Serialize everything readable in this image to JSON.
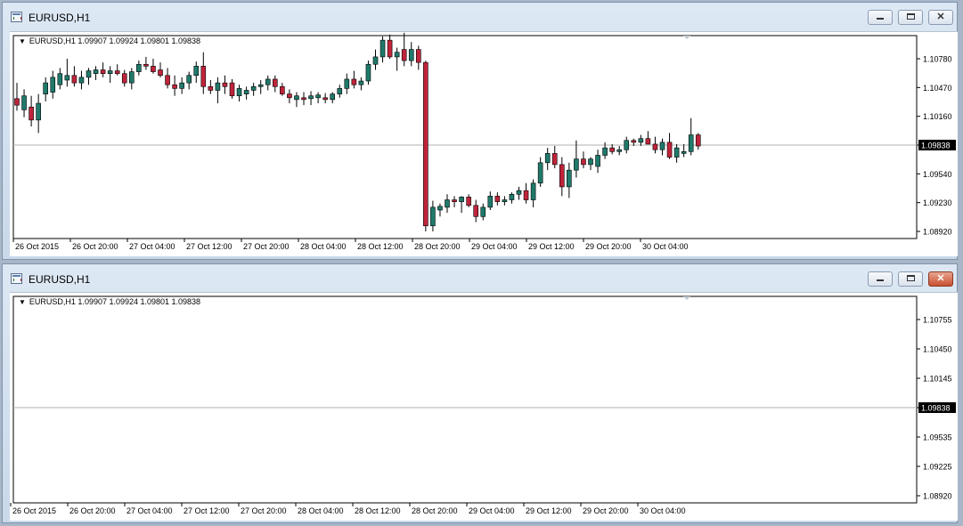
{
  "windows": [
    {
      "id": "win1",
      "title": "EURUSD,H1",
      "info_line": "EURUSD,H1  1.09907 1.09924 1.09801 1.09838",
      "chart_data": {
        "type": "candlestick",
        "symbol": "EURUSD",
        "timeframe": "H1",
        "y_ticks": [
          "1.10780",
          "1.10470",
          "1.10160",
          "1.09838",
          "1.09540",
          "1.09230",
          "1.08920"
        ],
        "current_price": "1.09838",
        "ylim": [
          1.0888,
          1.111
        ],
        "x_labels": [
          "26 Oct 2015",
          "26 Oct 20:00",
          "27 Oct 04:00",
          "27 Oct 12:00",
          "27 Oct 20:00",
          "28 Oct 04:00",
          "28 Oct 12:00",
          "28 Oct 20:00",
          "29 Oct 04:00",
          "29 Oct 12:00",
          "29 Oct 20:00",
          "30 Oct 04:00"
        ],
        "up_color": "#1f7a6b",
        "down_color": "#c0243b",
        "candles": [
          {
            "o": 1.1035,
            "h": 1.1052,
            "l": 1.1022,
            "c": 1.1028
          },
          {
            "o": 1.1023,
            "h": 1.1045,
            "l": 1.1015,
            "c": 1.1038
          },
          {
            "o": 1.1026,
            "h": 1.1038,
            "l": 1.1005,
            "c": 1.1012
          },
          {
            "o": 1.1012,
            "h": 1.104,
            "l": 1.0998,
            "c": 1.103
          },
          {
            "o": 1.104,
            "h": 1.1058,
            "l": 1.1032,
            "c": 1.1052
          },
          {
            "o": 1.1042,
            "h": 1.1065,
            "l": 1.1035,
            "c": 1.1058
          },
          {
            "o": 1.105,
            "h": 1.1068,
            "l": 1.1045,
            "c": 1.1062
          },
          {
            "o": 1.1055,
            "h": 1.1078,
            "l": 1.1048,
            "c": 1.106
          },
          {
            "o": 1.106,
            "h": 1.107,
            "l": 1.1048,
            "c": 1.1052
          },
          {
            "o": 1.1052,
            "h": 1.1065,
            "l": 1.1045,
            "c": 1.1058
          },
          {
            "o": 1.1058,
            "h": 1.1068,
            "l": 1.105,
            "c": 1.1065
          },
          {
            "o": 1.1062,
            "h": 1.107,
            "l": 1.1055,
            "c": 1.1066
          },
          {
            "o": 1.1066,
            "h": 1.1074,
            "l": 1.1058,
            "c": 1.1062
          },
          {
            "o": 1.1062,
            "h": 1.107,
            "l": 1.1052,
            "c": 1.1065
          },
          {
            "o": 1.1065,
            "h": 1.1072,
            "l": 1.106,
            "c": 1.1062
          },
          {
            "o": 1.1062,
            "h": 1.1066,
            "l": 1.1048,
            "c": 1.1052
          },
          {
            "o": 1.1052,
            "h": 1.1068,
            "l": 1.1045,
            "c": 1.1064
          },
          {
            "o": 1.1064,
            "h": 1.1076,
            "l": 1.106,
            "c": 1.1072
          },
          {
            "o": 1.1072,
            "h": 1.108,
            "l": 1.1066,
            "c": 1.107
          },
          {
            "o": 1.107,
            "h": 1.1078,
            "l": 1.1062,
            "c": 1.1064
          },
          {
            "o": 1.1066,
            "h": 1.1074,
            "l": 1.1058,
            "c": 1.106
          },
          {
            "o": 1.106,
            "h": 1.1068,
            "l": 1.1046,
            "c": 1.105
          },
          {
            "o": 1.105,
            "h": 1.106,
            "l": 1.1038,
            "c": 1.1046
          },
          {
            "o": 1.1046,
            "h": 1.1058,
            "l": 1.104,
            "c": 1.1052
          },
          {
            "o": 1.1052,
            "h": 1.1064,
            "l": 1.1045,
            "c": 1.106
          },
          {
            "o": 1.106,
            "h": 1.1075,
            "l": 1.1052,
            "c": 1.107
          },
          {
            "o": 1.107,
            "h": 1.1085,
            "l": 1.104,
            "c": 1.1048
          },
          {
            "o": 1.1048,
            "h": 1.1055,
            "l": 1.104,
            "c": 1.1044
          },
          {
            "o": 1.1044,
            "h": 1.1058,
            "l": 1.103,
            "c": 1.1052
          },
          {
            "o": 1.1052,
            "h": 1.106,
            "l": 1.104,
            "c": 1.1048
          },
          {
            "o": 1.1052,
            "h": 1.1056,
            "l": 1.1035,
            "c": 1.1038
          },
          {
            "o": 1.1038,
            "h": 1.105,
            "l": 1.1032,
            "c": 1.1046
          },
          {
            "o": 1.104,
            "h": 1.1048,
            "l": 1.1034,
            "c": 1.1044
          },
          {
            "o": 1.1044,
            "h": 1.1052,
            "l": 1.1038,
            "c": 1.1048
          },
          {
            "o": 1.1048,
            "h": 1.1055,
            "l": 1.104,
            "c": 1.105
          },
          {
            "o": 1.105,
            "h": 1.106,
            "l": 1.1044,
            "c": 1.1056
          },
          {
            "o": 1.1056,
            "h": 1.106,
            "l": 1.1042,
            "c": 1.1048
          },
          {
            "o": 1.1048,
            "h": 1.1052,
            "l": 1.1038,
            "c": 1.104
          },
          {
            "o": 1.104,
            "h": 1.1045,
            "l": 1.103,
            "c": 1.1036
          },
          {
            "o": 1.1034,
            "h": 1.1042,
            "l": 1.1026,
            "c": 1.1038
          },
          {
            "o": 1.1036,
            "h": 1.1042,
            "l": 1.1028,
            "c": 1.1034
          },
          {
            "o": 1.1035,
            "h": 1.1043,
            "l": 1.1028,
            "c": 1.1038
          },
          {
            "o": 1.1036,
            "h": 1.1042,
            "l": 1.103,
            "c": 1.1039
          },
          {
            "o": 1.1036,
            "h": 1.1041,
            "l": 1.103,
            "c": 1.1034
          },
          {
            "o": 1.1034,
            "h": 1.1042,
            "l": 1.103,
            "c": 1.104
          },
          {
            "o": 1.104,
            "h": 1.105,
            "l": 1.1036,
            "c": 1.1046
          },
          {
            "o": 1.1046,
            "h": 1.1062,
            "l": 1.104,
            "c": 1.1056
          },
          {
            "o": 1.1056,
            "h": 1.1065,
            "l": 1.1046,
            "c": 1.105
          },
          {
            "o": 1.105,
            "h": 1.1058,
            "l": 1.1044,
            "c": 1.1054
          },
          {
            "o": 1.1054,
            "h": 1.1076,
            "l": 1.105,
            "c": 1.1072
          },
          {
            "o": 1.1072,
            "h": 1.1088,
            "l": 1.1066,
            "c": 1.108
          },
          {
            "o": 1.108,
            "h": 1.1102,
            "l": 1.1074,
            "c": 1.1098
          },
          {
            "o": 1.1098,
            "h": 1.1104,
            "l": 1.1078,
            "c": 1.108
          },
          {
            "o": 1.108,
            "h": 1.109,
            "l": 1.1065,
            "c": 1.1085
          },
          {
            "o": 1.1088,
            "h": 1.1106,
            "l": 1.107,
            "c": 1.1076
          },
          {
            "o": 1.1076,
            "h": 1.1096,
            "l": 1.107,
            "c": 1.1088
          },
          {
            "o": 1.1088,
            "h": 1.1092,
            "l": 1.1066,
            "c": 1.1074
          },
          {
            "o": 1.1074,
            "h": 1.1076,
            "l": 1.0892,
            "c": 1.0898
          },
          {
            "o": 1.0898,
            "h": 1.0925,
            "l": 1.0892,
            "c": 1.0918
          },
          {
            "o": 1.0915,
            "h": 1.0922,
            "l": 1.0908,
            "c": 1.0919
          },
          {
            "o": 1.0918,
            "h": 1.0932,
            "l": 1.0912,
            "c": 1.0926
          },
          {
            "o": 1.0926,
            "h": 1.093,
            "l": 1.0918,
            "c": 1.0924
          },
          {
            "o": 1.0924,
            "h": 1.093,
            "l": 1.0912,
            "c": 1.0929
          },
          {
            "o": 1.0929,
            "h": 1.0932,
            "l": 1.0918,
            "c": 1.092
          },
          {
            "o": 1.092,
            "h": 1.0926,
            "l": 1.0902,
            "c": 1.0908
          },
          {
            "o": 1.0908,
            "h": 1.0922,
            "l": 1.0904,
            "c": 1.0918
          },
          {
            "o": 1.0918,
            "h": 1.0935,
            "l": 1.0915,
            "c": 1.093
          },
          {
            "o": 1.093,
            "h": 1.0934,
            "l": 1.092,
            "c": 1.0924
          },
          {
            "o": 1.0924,
            "h": 1.093,
            "l": 1.092,
            "c": 1.0926
          },
          {
            "o": 1.0926,
            "h": 1.0934,
            "l": 1.0922,
            "c": 1.0932
          },
          {
            "o": 1.0932,
            "h": 1.094,
            "l": 1.0926,
            "c": 1.0936
          },
          {
            "o": 1.0936,
            "h": 1.0944,
            "l": 1.0922,
            "c": 1.0926
          },
          {
            "o": 1.0926,
            "h": 1.0948,
            "l": 1.0918,
            "c": 1.0944
          },
          {
            "o": 1.0944,
            "h": 1.0972,
            "l": 1.094,
            "c": 1.0966
          },
          {
            "o": 1.0966,
            "h": 1.0982,
            "l": 1.0958,
            "c": 1.0976
          },
          {
            "o": 1.0976,
            "h": 1.0984,
            "l": 1.096,
            "c": 1.0964
          },
          {
            "o": 1.0964,
            "h": 1.0972,
            "l": 1.093,
            "c": 1.094
          },
          {
            "o": 1.094,
            "h": 1.0966,
            "l": 1.0928,
            "c": 1.0958
          },
          {
            "o": 1.0958,
            "h": 1.099,
            "l": 1.095,
            "c": 1.097
          },
          {
            "o": 1.097,
            "h": 1.0978,
            "l": 1.096,
            "c": 1.0964
          },
          {
            "o": 1.0964,
            "h": 1.0972,
            "l": 1.0958,
            "c": 1.097
          },
          {
            "o": 1.0962,
            "h": 1.098,
            "l": 1.0955,
            "c": 1.0974
          },
          {
            "o": 1.0974,
            "h": 1.0988,
            "l": 1.097,
            "c": 1.0982
          },
          {
            "o": 1.0982,
            "h": 1.0986,
            "l": 1.0975,
            "c": 1.0978
          },
          {
            "o": 1.0978,
            "h": 1.0984,
            "l": 1.0974,
            "c": 1.098
          },
          {
            "o": 1.098,
            "h": 1.0994,
            "l": 1.0976,
            "c": 1.099
          },
          {
            "o": 1.099,
            "h": 1.0992,
            "l": 1.0984,
            "c": 1.0988
          },
          {
            "o": 1.0988,
            "h": 1.0996,
            "l": 1.0984,
            "c": 1.0992
          },
          {
            "o": 1.0992,
            "h": 1.1,
            "l": 1.0988,
            "c": 1.0986
          },
          {
            "o": 1.0986,
            "h": 1.0994,
            "l": 1.0976,
            "c": 1.098
          },
          {
            "o": 1.098,
            "h": 1.0992,
            "l": 1.0974,
            "c": 1.0988
          },
          {
            "o": 1.0988,
            "h": 1.0998,
            "l": 1.097,
            "c": 1.0972
          },
          {
            "o": 1.0972,
            "h": 1.0986,
            "l": 1.0966,
            "c": 1.0982
          },
          {
            "o": 1.0976,
            "h": 1.0986,
            "l": 1.0972,
            "c": 1.0978
          },
          {
            "o": 1.0978,
            "h": 1.1014,
            "l": 1.0974,
            "c": 1.0996
          },
          {
            "o": 1.0996,
            "h": 1.0998,
            "l": 1.098,
            "c": 1.0984
          }
        ]
      }
    },
    {
      "id": "win2",
      "title": "EURUSD,H1",
      "info_line": "EURUSD,H1  1.09907 1.09924 1.09801 1.09838",
      "chart_data": {
        "type": "candlestick",
        "symbol": "EURUSD",
        "timeframe": "H1",
        "y_ticks": [
          "1.10755",
          "1.10450",
          "1.10145",
          "1.09838",
          "1.09535",
          "1.09225",
          "1.08920"
        ],
        "current_price": "1.09838",
        "x_labels": [
          "26 Oct 2015",
          "26 Oct 20:00",
          "27 Oct 04:00",
          "27 Oct 12:00",
          "27 Oct 20:00",
          "28 Oct 04:00",
          "28 Oct 12:00",
          "28 Oct 20:00",
          "29 Oct 04:00",
          "29 Oct 12:00",
          "29 Oct 20:00",
          "30 Oct 04:00"
        ],
        "candles": []
      }
    }
  ],
  "colors": {
    "current_price_bg": "#000000",
    "grid_line": "#b0b0b0"
  }
}
